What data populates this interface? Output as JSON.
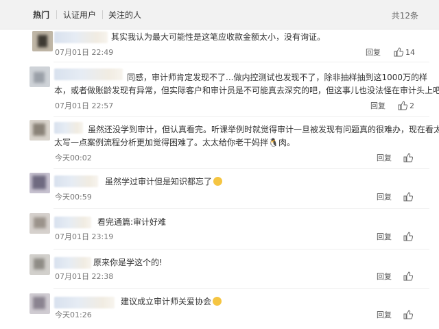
{
  "tabs": {
    "hot": "热门",
    "verified": "认证用户",
    "following": "关注的人",
    "total": "共12条"
  },
  "comments": [
    {
      "text": "其实我认为最大可能性是这笔应收款金额太小，没有询证。",
      "text2": "",
      "time": "07月01日 22:49",
      "reply": "回复",
      "likes": "14"
    },
    {
      "text": "同感，审计师肯定发现不了...做内控测试也发现不了，除非抽样抽到这1000万的样",
      "text2": "本，或者做账龄发现有异常，但实际客户和审计员是不可能真去深究的吧，但这事儿也没法怪在审计头上吧",
      "time": "07月01日 22:57",
      "reply": "回复",
      "likes": "2"
    },
    {
      "text": "虽然还没学到审计，但认真看完。听课举例时就觉得审计一旦被发现有问题真的很难办，现在看太",
      "text2": "太写一点案例流程分析更加觉得困难了。太太给你老干妈拌🐧肉。",
      "time": "今天00:02",
      "reply": "回复",
      "likes": ""
    },
    {
      "text": "虽然学过审计但是知识都忘了",
      "text2": "",
      "time": "今天00:59",
      "reply": "回复",
      "likes": ""
    },
    {
      "text": "看完通篇:审计好难",
      "text2": "",
      "time": "07月01日 23:19",
      "reply": "回复",
      "likes": ""
    },
    {
      "text": "原来你是学这个的!",
      "text2": "",
      "time": "07月01日 22:38",
      "reply": "回复",
      "likes": ""
    },
    {
      "text": "建议成立审计师关爱协会",
      "text2": "",
      "time": "今天01:26",
      "reply": "回复",
      "likes": ""
    }
  ]
}
